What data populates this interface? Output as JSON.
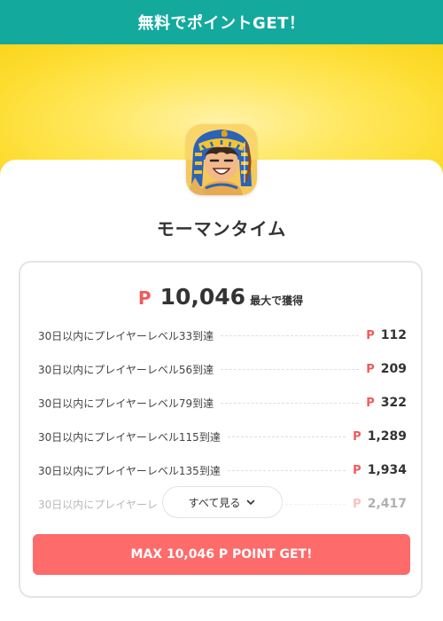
{
  "header": {
    "title": "無料でポイントGET！"
  },
  "app": {
    "name": "モーマンタイム",
    "icon": "pharaoh-character-icon"
  },
  "rewards": {
    "currency_symbol": "P",
    "max_total": "10,046",
    "max_label": "最大で獲得",
    "items": [
      {
        "label": "30日以内にプレイヤーレベル33到達",
        "points": "112"
      },
      {
        "label": "30日以内にプレイヤーレベル56到達",
        "points": "209"
      },
      {
        "label": "30日以内にプレイヤーレベル79到達",
        "points": "322"
      },
      {
        "label": "30日以内にプレイヤーレベル115到達",
        "points": "1,289"
      },
      {
        "label": "30日以内にプレイヤーレベル135到達",
        "points": "1,934"
      },
      {
        "label": "30日以内にプレイヤーレ",
        "points": "2,417"
      }
    ],
    "see_all_label": "すべて見る",
    "cta_label": "MAX 10,046 P POINT GET!"
  },
  "colors": {
    "header_bg": "#14a99d",
    "banner_yellow": "#fddd32",
    "point_red": "#f05a5a",
    "cta_bg": "#fd6b6b"
  }
}
